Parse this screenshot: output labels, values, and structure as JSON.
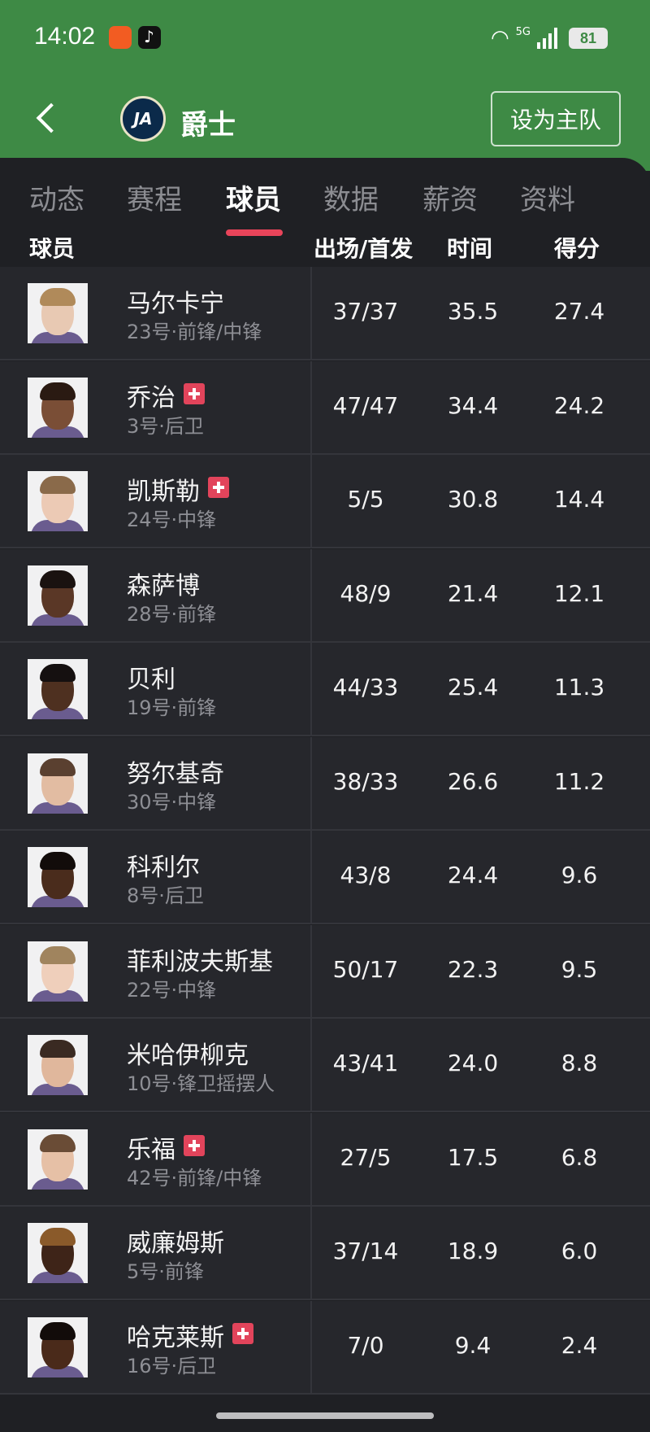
{
  "status_bar": {
    "time": "14:02",
    "network": "5G",
    "battery": "81"
  },
  "header": {
    "team_name": "爵士",
    "logo_text": "JA",
    "fav_button": "设为主队"
  },
  "tabs": [
    {
      "label": "动态",
      "active": false
    },
    {
      "label": "赛程",
      "active": false
    },
    {
      "label": "球员",
      "active": true
    },
    {
      "label": "数据",
      "active": false
    },
    {
      "label": "薪资",
      "active": false
    },
    {
      "label": "资料",
      "active": false
    }
  ],
  "columns": [
    "球员",
    "出场/首发",
    "时间",
    "得分"
  ],
  "players": [
    {
      "name": "马尔卡宁",
      "info": "23号·前锋/中锋",
      "games": "37/37",
      "minutes": "35.5",
      "points": "27.4",
      "injured": false,
      "skin": "#e8c9b3",
      "hair": "#b08a5a"
    },
    {
      "name": "乔治",
      "info": "3号·后卫",
      "games": "47/47",
      "minutes": "34.4",
      "points": "24.2",
      "injured": true,
      "skin": "#7a4e36",
      "hair": "#2a1a12"
    },
    {
      "name": "凯斯勒",
      "info": "24号·中锋",
      "games": "5/5",
      "minutes": "30.8",
      "points": "14.4",
      "injured": true,
      "skin": "#eccab5",
      "hair": "#8a6a4a"
    },
    {
      "name": "森萨博",
      "info": "28号·前锋",
      "games": "48/9",
      "minutes": "21.4",
      "points": "12.1",
      "injured": false,
      "skin": "#5a3726",
      "hair": "#1a1210"
    },
    {
      "name": "贝利",
      "info": "19号·前锋",
      "games": "44/33",
      "minutes": "25.4",
      "points": "11.3",
      "injured": false,
      "skin": "#4e3020",
      "hair": "#151010"
    },
    {
      "name": "努尔基奇",
      "info": "30号·中锋",
      "games": "38/33",
      "minutes": "26.6",
      "points": "11.2",
      "injured": false,
      "skin": "#e2bca2",
      "hair": "#5a4030"
    },
    {
      "name": "科利尔",
      "info": "8号·后卫",
      "games": "43/8",
      "minutes": "24.4",
      "points": "9.6",
      "injured": false,
      "skin": "#4a2c1c",
      "hair": "#120c0a"
    },
    {
      "name": "菲利波夫斯基",
      "info": "22号·中锋",
      "games": "50/17",
      "minutes": "22.3",
      "points": "9.5",
      "injured": false,
      "skin": "#efcfbb",
      "hair": "#a0845e"
    },
    {
      "name": "米哈伊柳克",
      "info": "10号·锋卫摇摆人",
      "games": "43/41",
      "minutes": "24.0",
      "points": "8.8",
      "injured": false,
      "skin": "#e0b79c",
      "hair": "#3a2a22"
    },
    {
      "name": "乐福",
      "info": "42号·前锋/中锋",
      "games": "27/5",
      "minutes": "17.5",
      "points": "6.8",
      "injured": true,
      "skin": "#e6c0a6",
      "hair": "#6a4c36"
    },
    {
      "name": "威廉姆斯",
      "info": "5号·前锋",
      "games": "37/14",
      "minutes": "18.9",
      "points": "6.0",
      "injured": false,
      "skin": "#3e2418",
      "hair": "#8a5a2a"
    },
    {
      "name": "哈克莱斯",
      "info": "16号·后卫",
      "games": "7/0",
      "minutes": "9.4",
      "points": "2.4",
      "injured": true,
      "skin": "#4a2a1a",
      "hair": "#120c0a"
    }
  ],
  "colors": {
    "header_green": "#3e8a45",
    "accent_red": "#e9445a",
    "row_bg": "#26272c",
    "page_bg": "#1f2024"
  }
}
